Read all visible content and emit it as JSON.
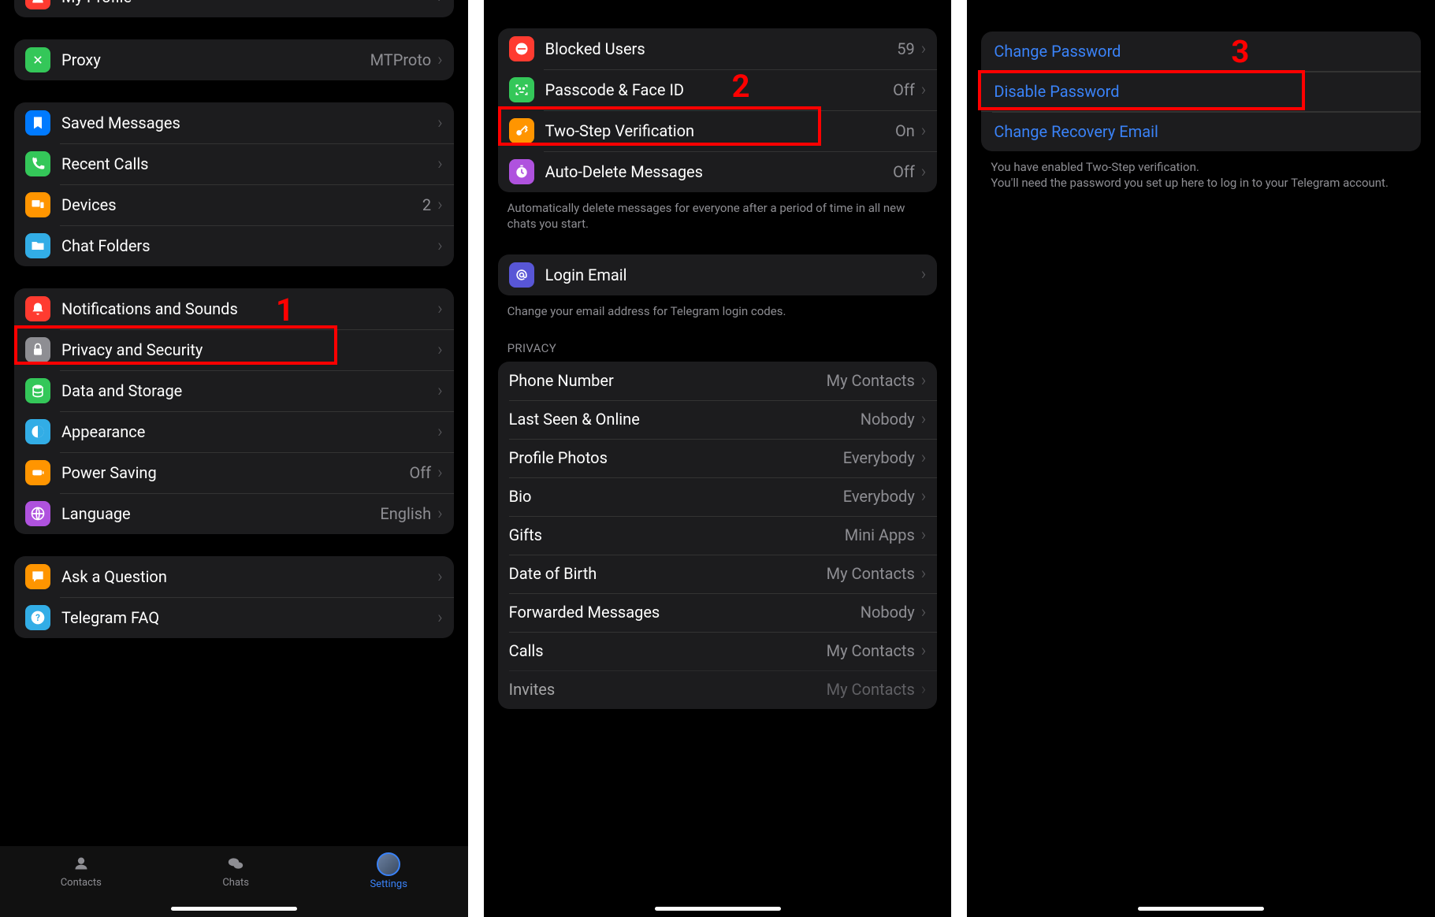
{
  "steps": {
    "s1": "1",
    "s2": "2",
    "s3": "3"
  },
  "panel1": {
    "my_profile": "My Profile",
    "proxy": {
      "label": "Proxy",
      "value": "MTProto"
    },
    "saved_messages": "Saved Messages",
    "recent_calls": "Recent Calls",
    "devices": {
      "label": "Devices",
      "value": "2"
    },
    "chat_folders": "Chat Folders",
    "notifications": "Notifications and Sounds",
    "privacy": "Privacy and Security",
    "data_storage": "Data and Storage",
    "appearance": "Appearance",
    "power_saving": {
      "label": "Power Saving",
      "value": "Off"
    },
    "language": {
      "label": "Language",
      "value": "English"
    },
    "ask_question": "Ask a Question",
    "telegram_faq": "Telegram FAQ",
    "tabs": {
      "contacts": "Contacts",
      "chats": "Chats",
      "settings": "Settings"
    }
  },
  "panel2": {
    "blocked": {
      "label": "Blocked Users",
      "value": "59"
    },
    "passcode": {
      "label": "Passcode & Face ID",
      "value": "Off"
    },
    "two_step": {
      "label": "Two-Step Verification",
      "value": "On"
    },
    "auto_delete": {
      "label": "Auto-Delete Messages",
      "value": "Off"
    },
    "auto_delete_footer": "Automatically delete messages for everyone after a period of time in all new chats you start.",
    "login_email": "Login Email",
    "login_email_footer": "Change your email address for Telegram login codes.",
    "privacy_header": "PRIVACY",
    "phone": {
      "label": "Phone Number",
      "value": "My Contacts"
    },
    "last_seen": {
      "label": "Last Seen & Online",
      "value": "Nobody"
    },
    "photos": {
      "label": "Profile Photos",
      "value": "Everybody"
    },
    "bio": {
      "label": "Bio",
      "value": "Everybody"
    },
    "gifts": {
      "label": "Gifts",
      "value": "Mini Apps"
    },
    "dob": {
      "label": "Date of Birth",
      "value": "My Contacts"
    },
    "forwarded": {
      "label": "Forwarded Messages",
      "value": "Nobody"
    },
    "calls": {
      "label": "Calls",
      "value": "My Contacts"
    },
    "invites": {
      "label": "Invites",
      "value": "My Contacts"
    }
  },
  "panel3": {
    "change_password": "Change Password",
    "disable_password": "Disable Password",
    "change_recovery": "Change Recovery Email",
    "footer": "You have enabled Two-Step verification.\nYou'll need the password you set up here to log in to your Telegram account."
  }
}
